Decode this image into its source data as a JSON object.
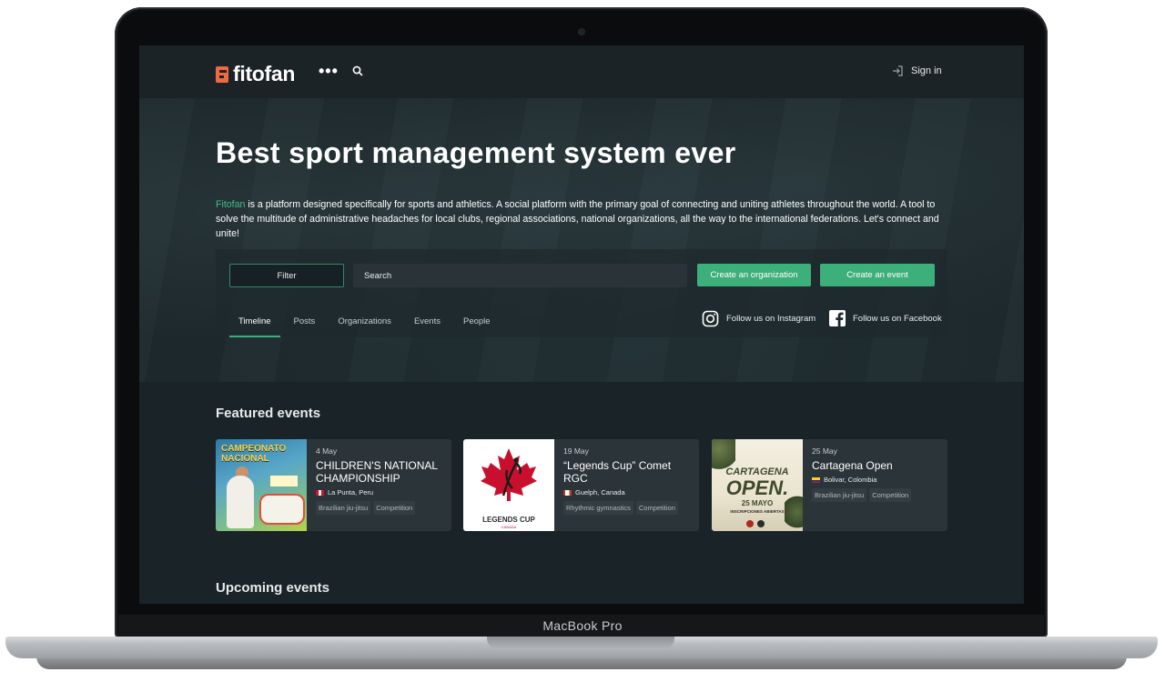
{
  "device": {
    "model_label": "MacBook Pro"
  },
  "header": {
    "logo_text": "fitofan",
    "menu_icon": "more-dots-icon",
    "search_icon": "search-icon",
    "signin_label": "Sign in"
  },
  "hero": {
    "title": "Best sport management system ever",
    "description_brand": "Fitofan",
    "description_rest": " is a platform designed specifically for sports and athletics. A social platform with the primary goal of connecting and uniting athletes throughout the world. A tool to solve the multitude of administrative headaches for local clubs, regional associations, national organizations, all the way to the international federations. Let's connect and unite!"
  },
  "toolbar": {
    "filter_label": "Filter",
    "search_placeholder": "Search",
    "create_org_label": "Create an organization",
    "create_event_label": "Create an event"
  },
  "tabs": [
    "Timeline",
    "Posts",
    "Organizations",
    "Events",
    "People"
  ],
  "social": {
    "instagram_label": "Follow us on Instagram",
    "facebook_label": "Follow us on Facebook"
  },
  "sections": {
    "featured": "Featured events",
    "upcoming": "Upcoming events"
  },
  "featured_events": [
    {
      "date": "4 May",
      "title": "CHILDREN'S NATIONAL CHAMPIONSHIP",
      "location": "La Punta, Peru",
      "tags": [
        "Brazilian jiu-jitsu",
        "Competition"
      ],
      "poster_text": "CAMPEONATO NACIONAL"
    },
    {
      "date": "19 May",
      "title": "“Legends Cup” Comet RGC",
      "location": "Guelph, Canada",
      "tags": [
        "Rhythmic gymnastics",
        "Competition"
      ],
      "poster_text": "LEGENDS CUP",
      "poster_subtext": "CANADA"
    },
    {
      "date": "25 May",
      "title": "Cartagena Open",
      "location": "Bolivar, Colombia",
      "tags": [
        "Brazilian jiu-jitsu",
        "Competition"
      ],
      "poster_text": "CARTAGENA",
      "poster_text2": "OPEN.",
      "poster_date": "25 MAYO",
      "poster_info": "INSCRIPCIONES ABIERTAS"
    }
  ],
  "colors": {
    "accent": "#3daf7a",
    "brand_logo": "#ee6a43",
    "background": "#1a2428"
  }
}
